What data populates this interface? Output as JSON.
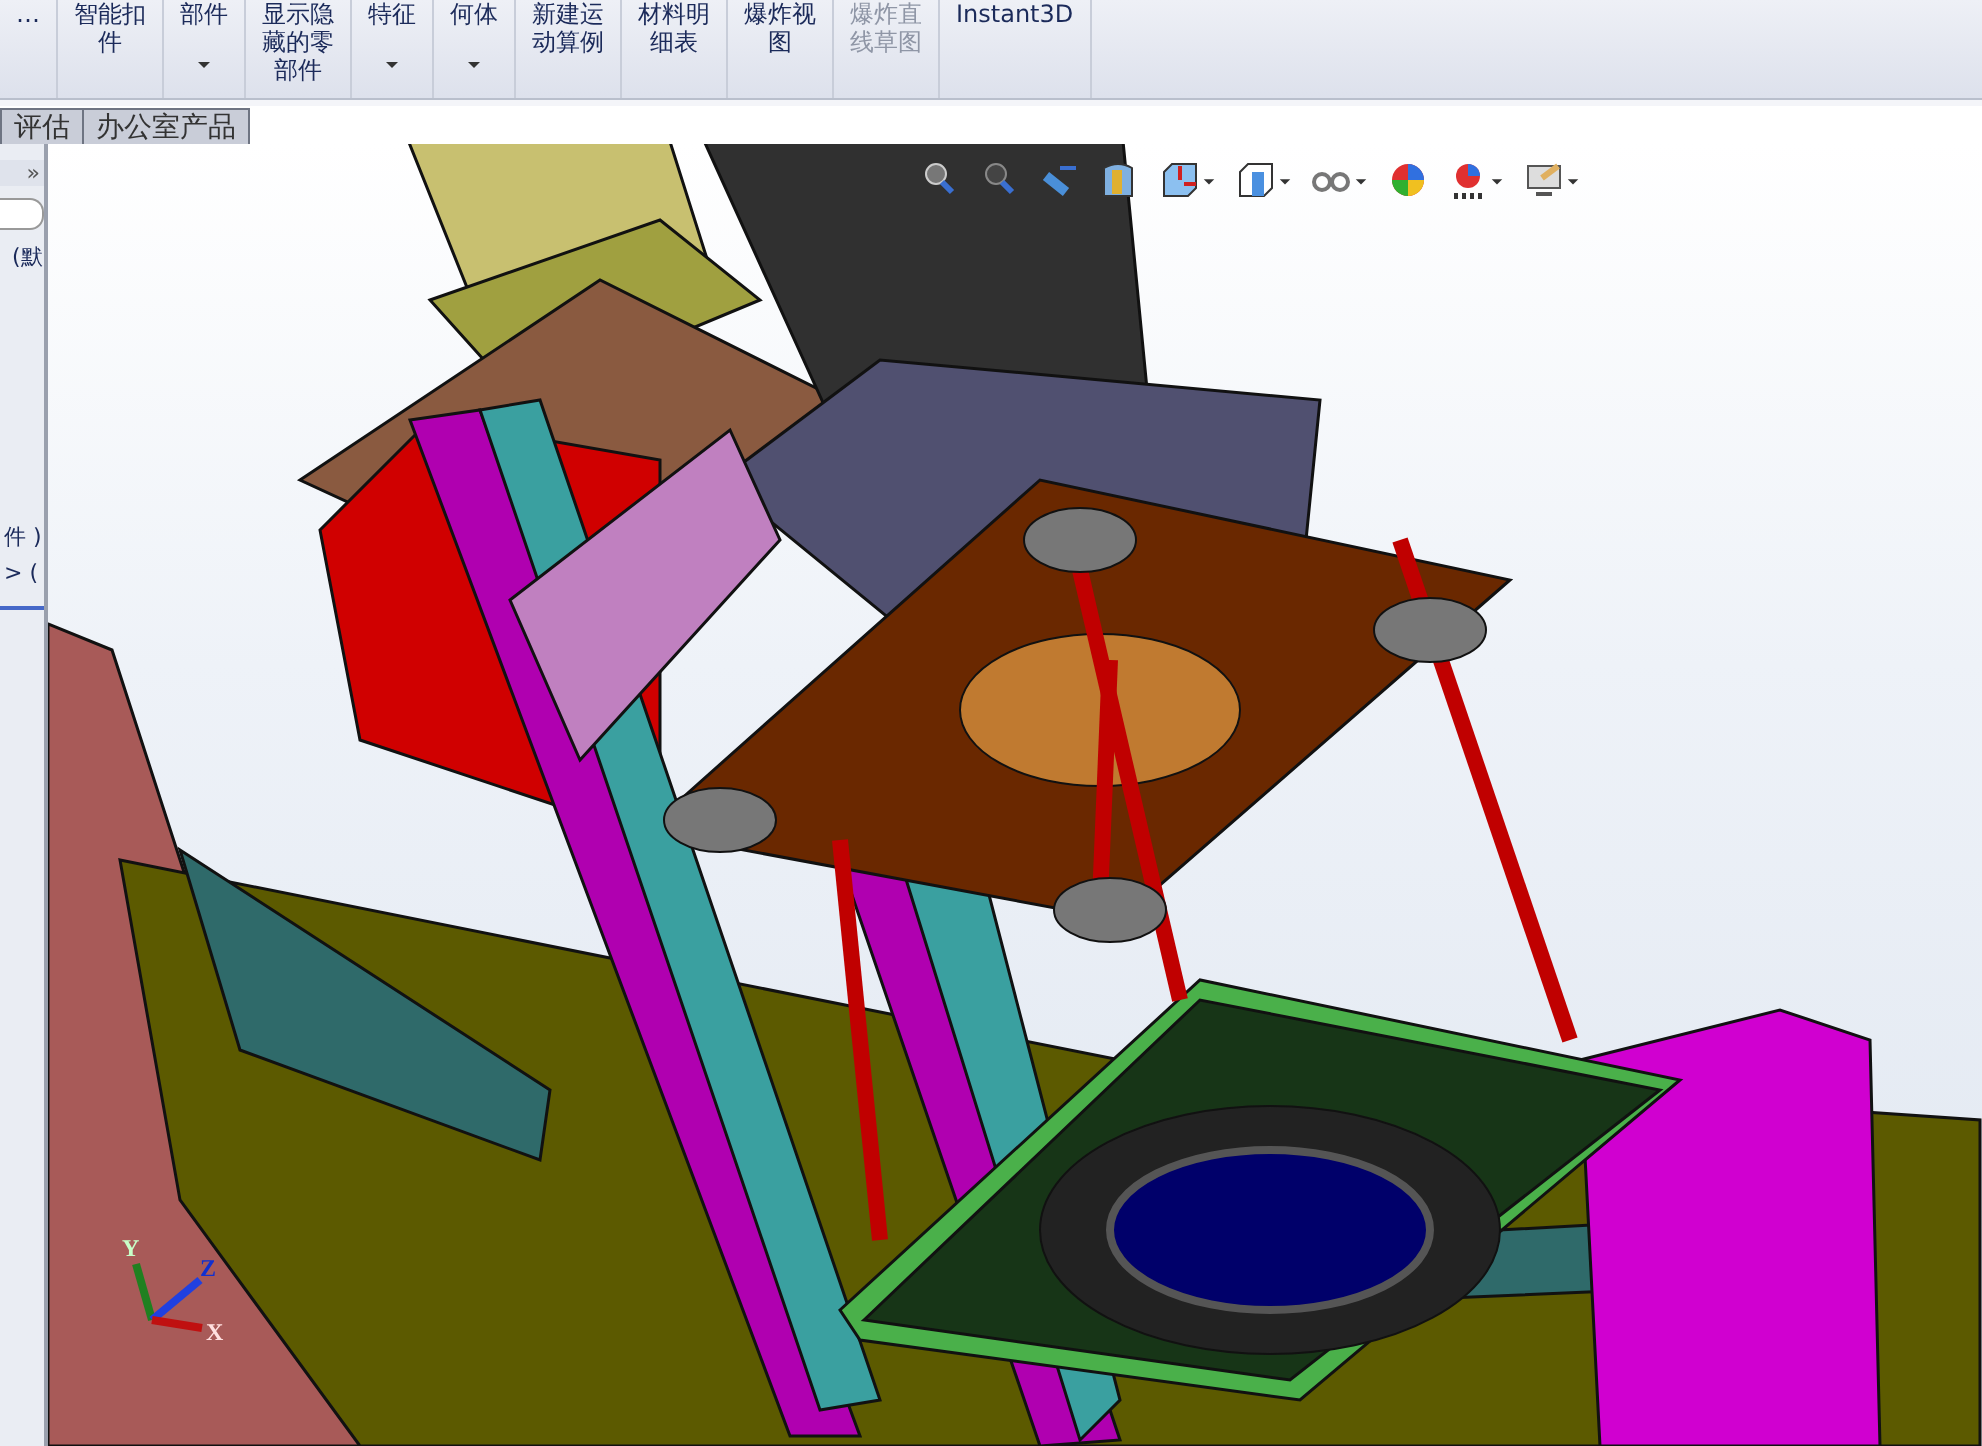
{
  "ribbon": {
    "buttons": [
      {
        "lines": [
          "…"
        ],
        "dropdown": false,
        "disabled": false
      },
      {
        "lines": [
          "智能扣",
          "件"
        ],
        "dropdown": false,
        "disabled": false
      },
      {
        "lines": [
          "部件"
        ],
        "dropdown": true,
        "disabled": false
      },
      {
        "lines": [
          "显示隐",
          "藏的零",
          "部件"
        ],
        "dropdown": false,
        "disabled": false
      },
      {
        "lines": [
          "特征"
        ],
        "dropdown": true,
        "disabled": false
      },
      {
        "lines": [
          "何体"
        ],
        "dropdown": true,
        "disabled": false
      },
      {
        "lines": [
          "新建运",
          "动算例"
        ],
        "dropdown": false,
        "disabled": false
      },
      {
        "lines": [
          "材料明",
          "细表"
        ],
        "dropdown": false,
        "disabled": false
      },
      {
        "lines": [
          "爆炸视",
          "图"
        ],
        "dropdown": false,
        "disabled": false
      },
      {
        "lines": [
          "爆炸直",
          "线草图"
        ],
        "dropdown": false,
        "disabled": true
      },
      {
        "lines": [
          "Instant3D"
        ],
        "dropdown": false,
        "disabled": false
      }
    ]
  },
  "tabs": [
    {
      "label": "评估",
      "selected": false
    },
    {
      "label": "办公室产品",
      "selected": false
    }
  ],
  "feature_tree": {
    "collapse": "»",
    "items": [
      "(默",
      "件 )",
      "> ("
    ]
  },
  "view_toolbar": {
    "icons": [
      {
        "kind": "zoom-fit",
        "dropdown": false
      },
      {
        "kind": "zoom-area",
        "dropdown": false
      },
      {
        "kind": "previous-view",
        "dropdown": false
      },
      {
        "kind": "section",
        "dropdown": false
      },
      {
        "kind": "orientation",
        "dropdown": true
      },
      {
        "kind": "display-style",
        "dropdown": true
      },
      {
        "kind": "hide-show",
        "dropdown": true
      },
      {
        "kind": "appearance",
        "dropdown": false
      },
      {
        "kind": "scene",
        "dropdown": true
      },
      {
        "kind": "view-settings",
        "dropdown": true
      }
    ]
  },
  "triad": {
    "labels": [
      "Y",
      "Z",
      "X"
    ]
  }
}
